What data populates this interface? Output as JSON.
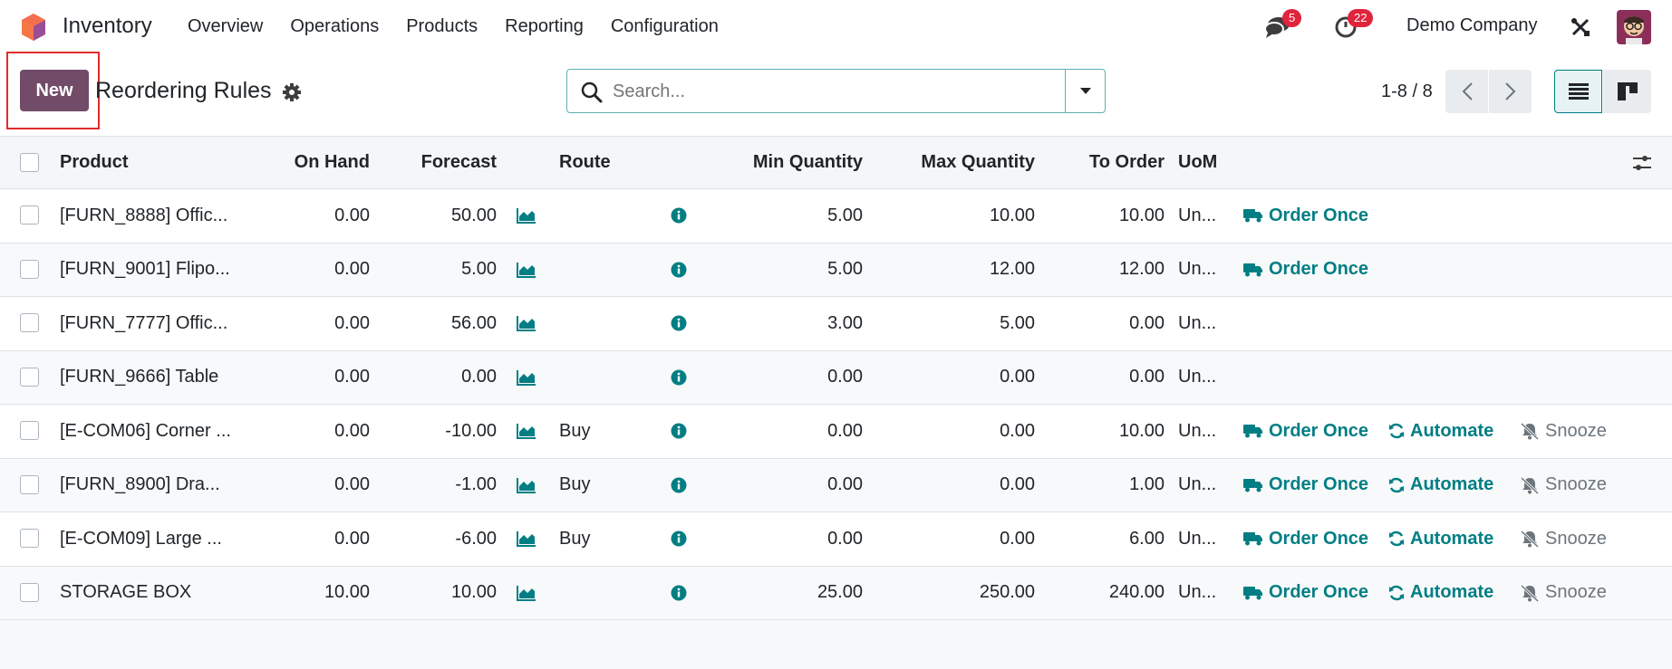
{
  "app": {
    "name": "Inventory"
  },
  "menu": [
    "Overview",
    "Operations",
    "Products",
    "Reporting",
    "Configuration"
  ],
  "systray": {
    "messages_count": "5",
    "activities_count": "22",
    "company": "Demo Company"
  },
  "control": {
    "new_label": "New",
    "title": "Reordering Rules",
    "search_placeholder": "Search...",
    "pager": "1-8 / 8"
  },
  "columns": [
    "Product",
    "On Hand",
    "Forecast",
    "Route",
    "Min Quantity",
    "Max Quantity",
    "To Order",
    "UoM"
  ],
  "actions": {
    "order_once": "Order Once",
    "automate": "Automate",
    "snooze": "Snooze"
  },
  "rows": [
    {
      "product": "[FURN_8888] Offic...",
      "on_hand": "0.00",
      "forecast": "50.00",
      "route": "",
      "min": "5.00",
      "max": "10.00",
      "to_order": "10.00",
      "uom": "Un...",
      "actions": [
        "order_once"
      ]
    },
    {
      "product": "[FURN_9001] Flipo...",
      "on_hand": "0.00",
      "forecast": "5.00",
      "route": "",
      "min": "5.00",
      "max": "12.00",
      "to_order": "12.00",
      "uom": "Un...",
      "actions": [
        "order_once"
      ]
    },
    {
      "product": "[FURN_7777] Offic...",
      "on_hand": "0.00",
      "forecast": "56.00",
      "route": "",
      "min": "3.00",
      "max": "5.00",
      "to_order": "0.00",
      "uom": "Un...",
      "actions": []
    },
    {
      "product": "[FURN_9666] Table",
      "on_hand": "0.00",
      "forecast": "0.00",
      "route": "",
      "min": "0.00",
      "max": "0.00",
      "to_order": "0.00",
      "uom": "Un...",
      "actions": []
    },
    {
      "product": "[E-COM06] Corner ...",
      "on_hand": "0.00",
      "forecast": "-10.00",
      "route": "Buy",
      "min": "0.00",
      "max": "0.00",
      "to_order": "10.00",
      "uom": "Un...",
      "actions": [
        "order_once",
        "automate",
        "snooze"
      ]
    },
    {
      "product": "[FURN_8900] Dra...",
      "on_hand": "0.00",
      "forecast": "-1.00",
      "route": "Buy",
      "min": "0.00",
      "max": "0.00",
      "to_order": "1.00",
      "uom": "Un...",
      "actions": [
        "order_once",
        "automate",
        "snooze"
      ]
    },
    {
      "product": "[E-COM09] Large ...",
      "on_hand": "0.00",
      "forecast": "-6.00",
      "route": "Buy",
      "min": "0.00",
      "max": "0.00",
      "to_order": "6.00",
      "uom": "Un...",
      "actions": [
        "order_once",
        "automate",
        "snooze"
      ]
    },
    {
      "product": "STORAGE BOX",
      "on_hand": "10.00",
      "forecast": "10.00",
      "route": "",
      "min": "25.00",
      "max": "250.00",
      "to_order": "240.00",
      "uom": "Un...",
      "actions": [
        "order_once",
        "automate",
        "snooze"
      ]
    }
  ],
  "colors": {
    "brand": "#714b67",
    "action": "#017e84",
    "badge": "#e0243c",
    "highlight": "#e22b2b"
  }
}
